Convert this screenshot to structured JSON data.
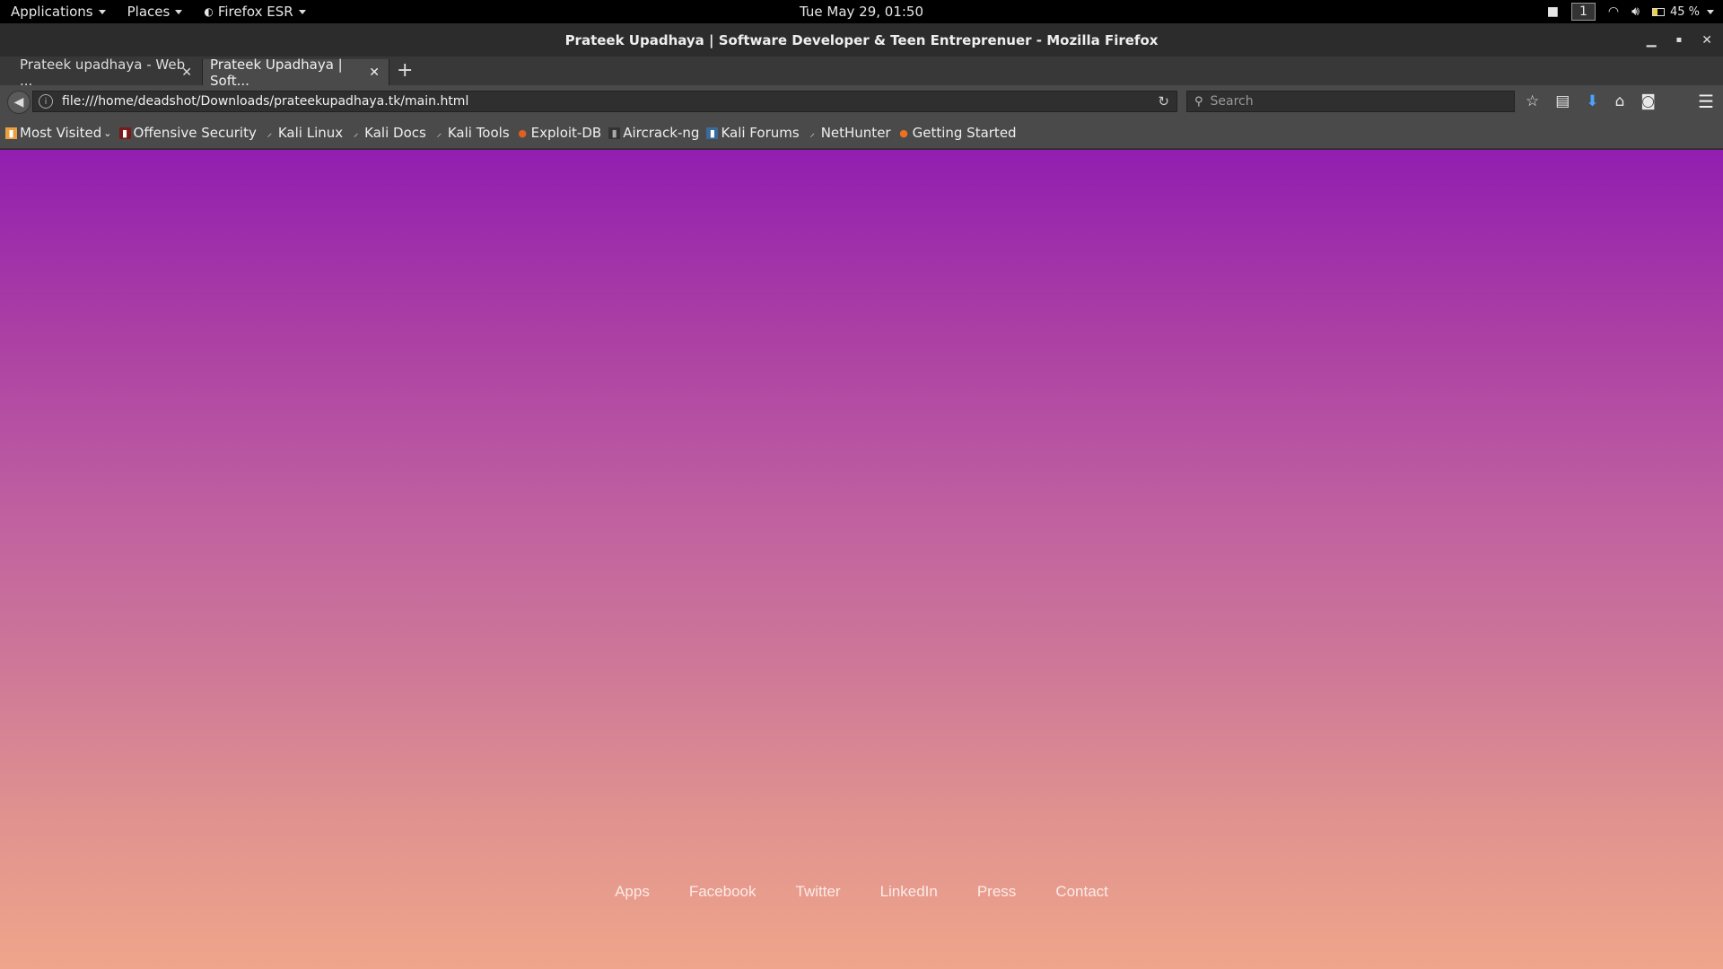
{
  "system_bar": {
    "applications": "Applications",
    "places": "Places",
    "firefox_menu": "Firefox ESR",
    "clock": "Tue May 29, 01:50",
    "workspace": "1",
    "battery": "45 %"
  },
  "window": {
    "title": "Prateek Upadhaya | Software Developer & Teen Entreprenuer - Mozilla Firefox"
  },
  "tabs": [
    {
      "label": "Prateek upadhaya - Web ...",
      "active": false
    },
    {
      "label": "Prateek Upadhaya | Soft...",
      "active": true
    }
  ],
  "navbar": {
    "url": "file:///home/deadshot/Downloads/prateekupadhaya.tk/main.html",
    "search_placeholder": "Search"
  },
  "bookmarks": [
    {
      "label": "Most Visited",
      "icon": "folder-icon"
    },
    {
      "label": "Offensive Security",
      "icon": "offsec-icon"
    },
    {
      "label": "Kali Linux",
      "icon": "kali-dragon-icon"
    },
    {
      "label": "Kali Docs",
      "icon": "kali-dragon-icon"
    },
    {
      "label": "Kali Tools",
      "icon": "kali-dragon-icon"
    },
    {
      "label": "Exploit-DB",
      "icon": "exploit-db-icon"
    },
    {
      "label": "Aircrack-ng",
      "icon": "aircrack-icon"
    },
    {
      "label": "Kali Forums",
      "icon": "kali-forums-icon"
    },
    {
      "label": "NetHunter",
      "icon": "kali-dragon-icon"
    },
    {
      "label": "Getting Started",
      "icon": "firefox-icon"
    }
  ],
  "footer_links": [
    "Apps",
    "Facebook",
    "Twitter",
    "LinkedIn",
    "Press",
    "Contact"
  ],
  "colors": {
    "gradient_top": "#921eb0",
    "gradient_bottom": "#efa58a"
  }
}
